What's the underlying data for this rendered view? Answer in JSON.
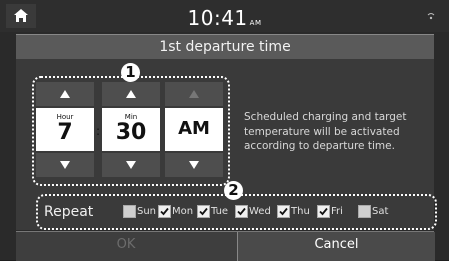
{
  "status_bar": {
    "time": "10:41",
    "ampm": "AM"
  },
  "header": {
    "title": "1st departure time"
  },
  "markers": {
    "one": "1",
    "two": "2"
  },
  "time_picker": {
    "hour": {
      "label": "Hour",
      "value": "7"
    },
    "min": {
      "label": "Min",
      "value": "30"
    },
    "period": {
      "value": "AM"
    },
    "separator": ":"
  },
  "info_text": "Scheduled charging and target temperature will be activated according to departure time.",
  "repeat": {
    "label": "Repeat",
    "days": [
      {
        "label": "Sun",
        "checked": false
      },
      {
        "label": "Mon",
        "checked": true
      },
      {
        "label": "Tue",
        "checked": true
      },
      {
        "label": "Wed",
        "checked": true
      },
      {
        "label": "Thu",
        "checked": true
      },
      {
        "label": "Fri",
        "checked": true
      },
      {
        "label": "Sat",
        "checked": false
      }
    ]
  },
  "footer": {
    "ok_label": "OK",
    "cancel_label": "Cancel"
  }
}
